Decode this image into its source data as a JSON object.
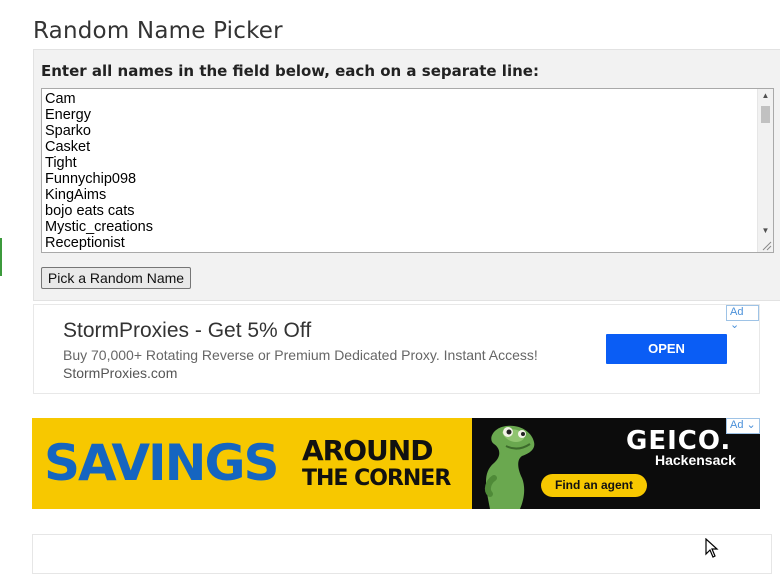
{
  "page": {
    "title": "Random Name Picker",
    "instructions": "Enter all names in the field below, each on a separate line:",
    "names": [
      "Cam",
      "Energy",
      "Sparko",
      "Casket",
      "Tight",
      "Funnychip098",
      "KingAims",
      "bojo eats cats",
      "Mystic_creations",
      "Receptionist"
    ],
    "pick_button_label": "Pick a Random Name"
  },
  "ads": {
    "badge_label": "Ad",
    "text_ad": {
      "headline": "StormProxies - Get 5% Off",
      "description": "Buy 70,000+ Rotating Reverse or Premium Dedicated Proxy. Instant Access!",
      "domain": "StormProxies.com",
      "cta": "OPEN",
      "cta_color": "#0a5df5"
    },
    "banner_ad": {
      "headline_big": "SAVINGS",
      "headline_line1": "AROUND",
      "headline_line2": "THE CORNER",
      "brand": "GEICO.",
      "location": "Hackensack",
      "cta": "Find an agent",
      "yellow": "#f7c800",
      "blue": "#1565c0"
    }
  }
}
